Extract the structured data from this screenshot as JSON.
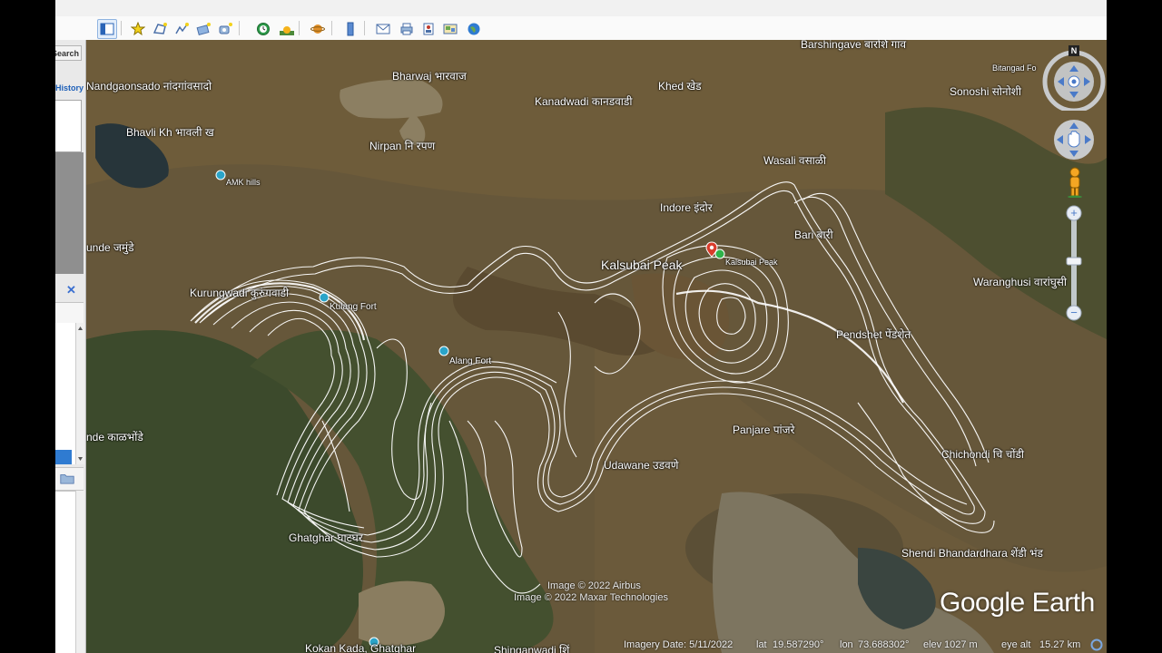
{
  "window": {
    "left_tab_labels": {
      "search": "Search",
      "history": "History"
    }
  },
  "toolbar": {
    "buttons": [
      {
        "name": "hide-sidebar-button",
        "icon": "sidebar-icon"
      },
      {
        "name": "add-placemark-button",
        "icon": "pushpin-icon"
      },
      {
        "name": "add-polygon-button",
        "icon": "polygon-icon"
      },
      {
        "name": "add-path-button",
        "icon": "path-icon"
      },
      {
        "name": "add-image-overlay-button",
        "icon": "overlay-icon"
      },
      {
        "name": "record-tour-button",
        "icon": "camera-icon"
      },
      {
        "name": "historical-imagery-button",
        "icon": "clock-icon"
      },
      {
        "name": "sunlight-button",
        "icon": "sun-icon"
      },
      {
        "name": "switch-planet-button",
        "icon": "planet-icon"
      },
      {
        "name": "ruler-button",
        "icon": "ruler-icon"
      },
      {
        "name": "email-button",
        "icon": "email-icon"
      },
      {
        "name": "print-button",
        "icon": "printer-icon"
      },
      {
        "name": "save-image-button",
        "icon": "save-image-icon"
      },
      {
        "name": "view-in-maps-button",
        "icon": "map-icon"
      },
      {
        "name": "earth-gallery-button",
        "icon": "globe-icon"
      }
    ]
  },
  "map": {
    "labels": [
      {
        "id": "barshingave",
        "text": "Barshingave बारशिं गाव"
      },
      {
        "id": "bitangad",
        "text": "Bitangad Fo"
      },
      {
        "id": "nandgaon",
        "text": "Nandgaonsado नांदगांवसादो"
      },
      {
        "id": "bharwaj",
        "text": "Bharwaj भारवाज"
      },
      {
        "id": "kanadwadi",
        "text": "Kanadwadi कानडवाडी"
      },
      {
        "id": "khed",
        "text": "Khed खेड"
      },
      {
        "id": "sonoshi",
        "text": "Sonoshi सोनोशी"
      },
      {
        "id": "bhavli",
        "text": "Bhavli Kh भावली ख"
      },
      {
        "id": "nirpan",
        "text": "Nirpan नि रपण"
      },
      {
        "id": "wasali",
        "text": "Wasali वसाळी"
      },
      {
        "id": "amk",
        "text": "AMK hills"
      },
      {
        "id": "indore",
        "text": "Indore इंदोर"
      },
      {
        "id": "bari",
        "text": "Bari बारी"
      },
      {
        "id": "unde",
        "text": "unde जमुंडे"
      },
      {
        "id": "kalsubai",
        "text": "Kalsubai Peak"
      },
      {
        "id": "kalsubai-small",
        "text": "Kalsubai Peak"
      },
      {
        "id": "waranghusi",
        "text": "Waranghusi वारांघुसी"
      },
      {
        "id": "kurungwadi",
        "text": "Kurungwadi कुरुंगवाडी"
      },
      {
        "id": "kulang",
        "text": "Kulang Fort"
      },
      {
        "id": "pendshet",
        "text": "Pendshet पेंडशेत"
      },
      {
        "id": "alang",
        "text": "Alang Fort"
      },
      {
        "id": "kalbhonde",
        "text": "nde काळभोंडे"
      },
      {
        "id": "panjare",
        "text": "Panjare पांजरे"
      },
      {
        "id": "chichondi",
        "text": "Chichondi चि चोंडी"
      },
      {
        "id": "udawane",
        "text": "Udawane उडवणे"
      },
      {
        "id": "ghatghar",
        "text": "Ghatghar घाटघर"
      },
      {
        "id": "shendi",
        "text": "Shendi Bhandardhara शेंडी भंड"
      },
      {
        "id": "kokankada",
        "text": "Kokan Kada, Ghatghar"
      },
      {
        "id": "shinganwadi",
        "text": "Shinganwadi शिं"
      }
    ],
    "credits": [
      "Image © 2022 Airbus",
      "Image © 2022 Maxar Technologies"
    ],
    "logo": "Google Earth",
    "north_label": "N"
  },
  "status": {
    "imagery_date": "Imagery Date: 5/11/2022",
    "lat_label": "lat",
    "lat": "19.587290°",
    "lon_label": "lon",
    "lon": "73.688302°",
    "elev_label": "elev",
    "elev": "1027 m",
    "eye_label": "eye alt",
    "eye": "15.27 km"
  },
  "colors": {
    "terrain": "#6b5b3a",
    "forest": "#3d4a2a",
    "water": "#34444a",
    "contour": "#ffffff",
    "panel": "#e9e9e9",
    "accent": "#2f7bd1"
  }
}
